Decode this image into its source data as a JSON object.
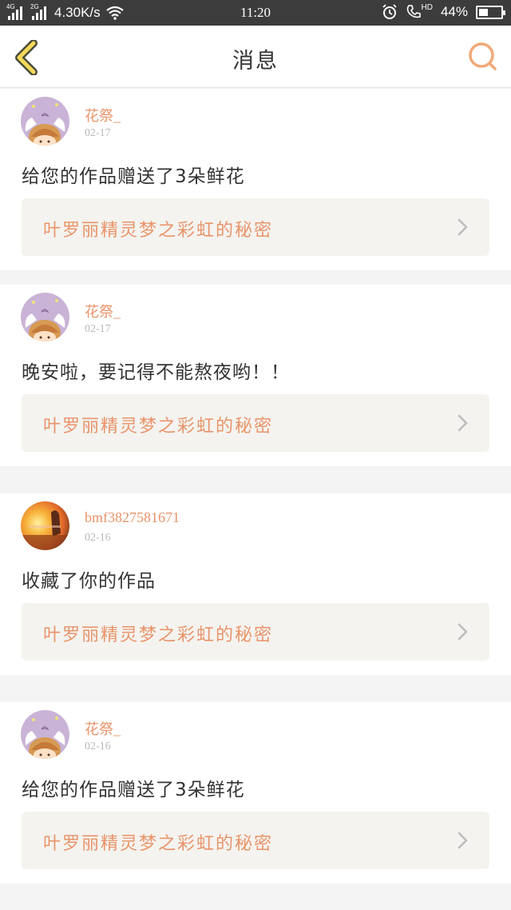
{
  "status_bar": {
    "net_speed": "4.30K/s",
    "time": "11:20",
    "battery": "44%",
    "battery_level": 0.44,
    "signal1_tag": "4G",
    "signal2_tag": "2G",
    "hd_tag": "HD"
  },
  "header": {
    "title": "消息"
  },
  "messages": [
    {
      "username": "花祭_",
      "date": "02-17",
      "text": "给您的作品赠送了3朵鲜花",
      "work_title": "叶罗丽精灵梦之彩虹的秘密"
    },
    {
      "username": "花祭_",
      "date": "02-17",
      "text": "晚安啦，要记得不能熬夜哟！！",
      "work_title": "叶罗丽精灵梦之彩虹的秘密"
    },
    {
      "username": "bmf3827581671",
      "date": "02-16",
      "text": "收藏了你的作品",
      "work_title": "叶罗丽精灵梦之彩虹的秘密"
    },
    {
      "username": "花祭_",
      "date": "02-16",
      "text": "给您的作品赠送了3朵鲜花",
      "work_title": "叶罗丽精灵梦之彩虹的秘密"
    }
  ],
  "colors": {
    "accent": "#e8946a",
    "card_inner": "#f4f3ef",
    "status_bar": "#3c3c3c"
  }
}
